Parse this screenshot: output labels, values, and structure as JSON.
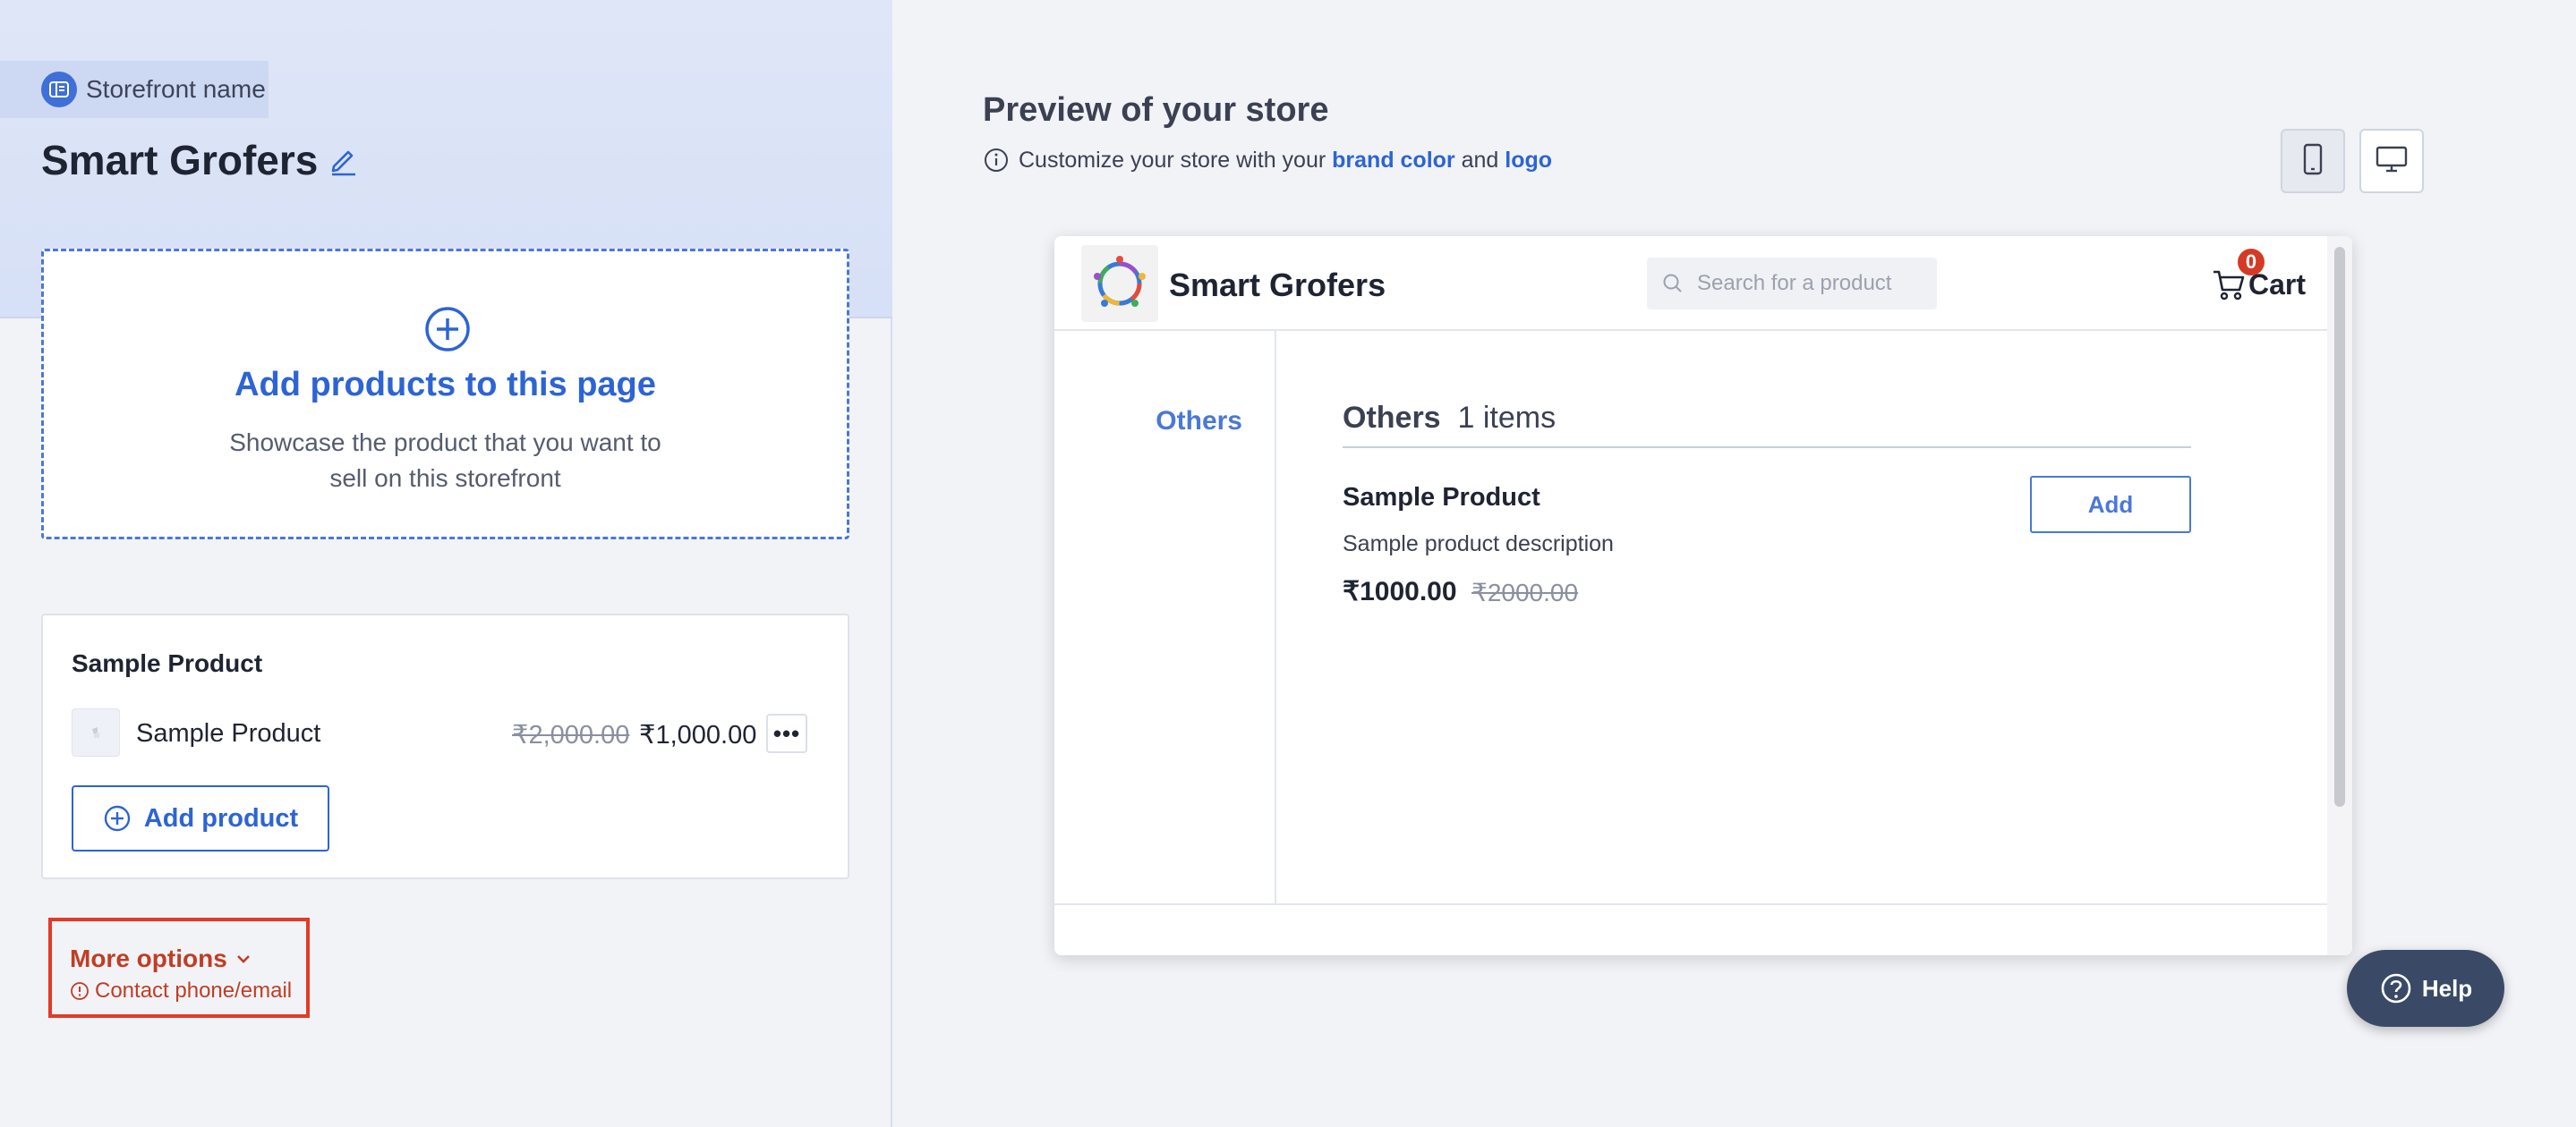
{
  "colors": {
    "accent": "#2d64d5",
    "highlight_border": "#e23b27",
    "help_bg": "#3a4a66",
    "cart_badge": "#d43a26"
  },
  "left": {
    "storefront_label": "Storefront name",
    "store_name": "Smart Grofers",
    "add_box": {
      "title": "Add products to this page",
      "description": "Showcase the product that you want to sell on this storefront"
    },
    "product_card": {
      "title": "Sample Product",
      "item": {
        "name": "Sample Product",
        "original_price": "₹2,000.00",
        "price": "₹1,000.00"
      },
      "more_label": "•••",
      "add_product_label": "Add product"
    },
    "more_options": {
      "label": "More options",
      "contact": "Contact phone/email"
    }
  },
  "preview": {
    "title": "Preview of your store",
    "subtitle_prefix": "Customize your store with your",
    "brand_color_link": "brand color",
    "subtitle_and": "and",
    "logo_link": "logo",
    "device_icons": [
      "mobile-icon",
      "desktop-icon"
    ],
    "store": {
      "name": "Smart Grofers",
      "search_placeholder": "Search for a product",
      "cart_label": "Cart",
      "cart_count": "0",
      "category": "Others",
      "section_name": "Others",
      "section_count": "1 items",
      "item": {
        "name": "Sample Product",
        "description": "Sample product description",
        "price": "₹1000.00",
        "original_price": "₹2000.00",
        "add_label": "Add"
      }
    }
  },
  "help": {
    "label": "Help"
  }
}
